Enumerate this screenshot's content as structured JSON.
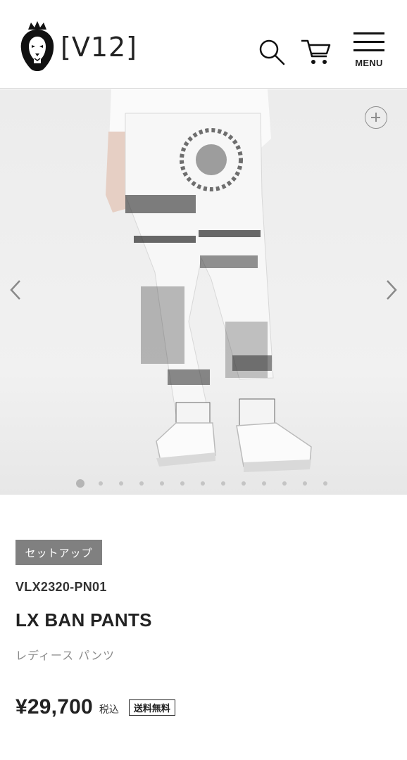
{
  "header": {
    "brand": "[V12]",
    "logo_icon": "crowned-lion-icon",
    "search_icon": "search-icon",
    "cart_icon": "cart-icon",
    "menu_label": "MENU"
  },
  "gallery": {
    "image_alt": "LX BAN PANTS",
    "zoom_icon": "zoom-plus-icon",
    "slide_count": 13,
    "active_slide": 1
  },
  "product": {
    "badge": "セットアップ",
    "sku": "VLX2320-PN01",
    "name": "LX BAN PANTS",
    "category": "レディース パンツ",
    "price": "¥29,700",
    "tax_label": "税込",
    "shipping_label": "送料無料"
  }
}
